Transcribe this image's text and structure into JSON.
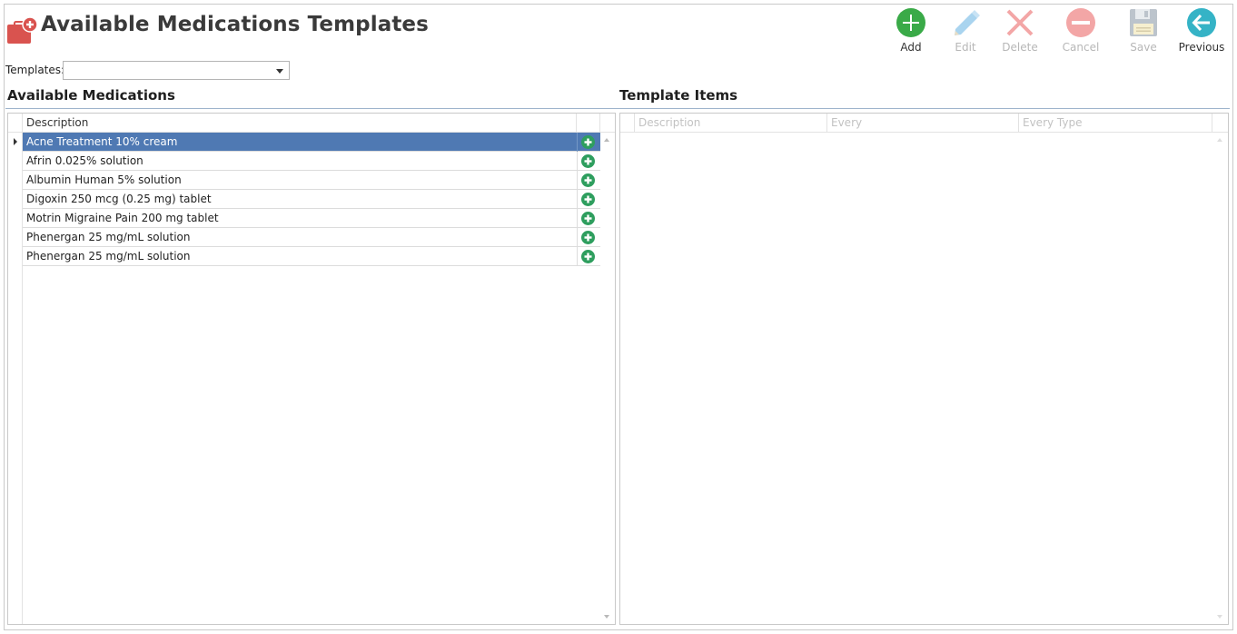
{
  "header": {
    "title": "Available Medications Templates",
    "app_icon": "medication-case-icon"
  },
  "toolbar": {
    "buttons": [
      {
        "label": "Add",
        "icon": "add-circle-icon",
        "enabled": true,
        "color": "#3aaa48"
      },
      {
        "label": "Edit",
        "icon": "pencil-icon",
        "enabled": false,
        "color": "#a9d4ef"
      },
      {
        "label": "Delete",
        "icon": "delete-x-icon",
        "enabled": false,
        "color": "#f3a6a6"
      },
      {
        "label": "Cancel",
        "icon": "cancel-minus-icon",
        "enabled": false,
        "color": "#f3a6a6"
      },
      {
        "label": "Save",
        "icon": "floppy-disk-icon",
        "enabled": false,
        "color": "#bcc4cc"
      },
      {
        "label": "Previous",
        "icon": "previous-arrow-icon",
        "enabled": true,
        "color": "#35b3c6"
      }
    ]
  },
  "templates": {
    "label": "Templates:",
    "value": ""
  },
  "available_medications": {
    "title": "Available Medications",
    "columns": [
      "Description"
    ],
    "selected_index": 0,
    "rows": [
      {
        "description": "Acne Treatment 10% cream"
      },
      {
        "description": "Afrin 0.025% solution"
      },
      {
        "description": "Albumin Human 5% solution"
      },
      {
        "description": "Digoxin 250 mcg (0.25 mg) tablet"
      },
      {
        "description": "Motrin Migraine Pain 200 mg tablet"
      },
      {
        "description": "Phenergan 25 mg/mL solution"
      },
      {
        "description": "Phenergan 25 mg/mL solution"
      }
    ]
  },
  "template_items": {
    "title": "Template Items",
    "columns": [
      "Description",
      "Every",
      "Every Type"
    ],
    "rows": []
  },
  "colors": {
    "selected_row": "#4f79b3",
    "add_icon_green": "#2e9e5e",
    "section_rule": "#9db4cc"
  }
}
